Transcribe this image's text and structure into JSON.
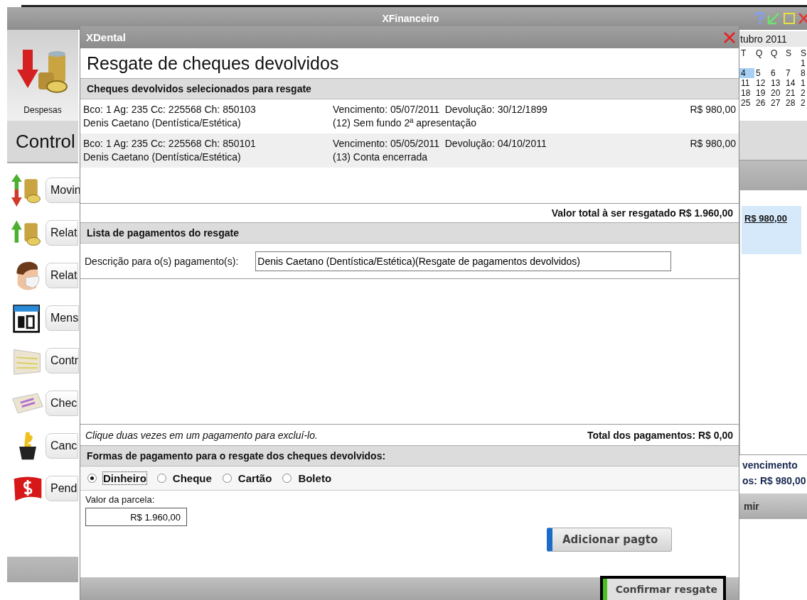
{
  "app": {
    "title": "XFinanceiro",
    "top_tile": {
      "label": "Despesas"
    },
    "heading": "Control",
    "sidebar": {
      "items": [
        {
          "label": "Movin",
          "kind": "transfer"
        },
        {
          "label": "Relat",
          "kind": "income"
        },
        {
          "label": "Relat",
          "kind": "person"
        },
        {
          "label": "Mens",
          "kind": "calendar"
        },
        {
          "label": "Contr",
          "kind": "document"
        },
        {
          "label": "Chec",
          "kind": "cheques"
        },
        {
          "label": "Canc",
          "kind": "bucket"
        },
        {
          "label": "Pend",
          "kind": "flag"
        }
      ]
    },
    "calendar": {
      "month": "tubro 2011",
      "weekdays": [
        "T",
        "Q",
        "Q",
        "S",
        "S"
      ],
      "weeks": [
        {
          "kind": "partial",
          "days": [
            {
              "day": "1",
              "selected": false
            }
          ]
        },
        {
          "kind": "full",
          "days": [
            {
              "day": "4",
              "selected": true
            },
            {
              "day": "5",
              "selected": false
            },
            {
              "day": "6",
              "selected": false
            },
            {
              "day": "7",
              "selected": false
            },
            {
              "day": "8",
              "selected": false
            }
          ]
        },
        {
          "kind": "full",
          "days": [
            {
              "day": "11",
              "selected": false
            },
            {
              "day": "12",
              "selected": false
            },
            {
              "day": "13",
              "selected": false
            },
            {
              "day": "14",
              "selected": false
            },
            {
              "day": "1",
              "selected": false
            }
          ]
        },
        {
          "kind": "full",
          "days": [
            {
              "day": "18",
              "selected": false
            },
            {
              "day": "19",
              "selected": false
            },
            {
              "day": "20",
              "selected": false
            },
            {
              "day": "21",
              "selected": false
            },
            {
              "day": "2",
              "selected": false
            }
          ]
        },
        {
          "kind": "full",
          "days": [
            {
              "day": "25",
              "selected": false
            },
            {
              "day": "26",
              "selected": false
            },
            {
              "day": "27",
              "selected": false
            },
            {
              "day": "28",
              "selected": false
            },
            {
              "day": "2",
              "selected": false
            }
          ]
        }
      ]
    },
    "summary": {
      "amount": "R$ 980,00",
      "due_label": "vencimento",
      "total": "os: R$ 980,00",
      "button": "mir"
    }
  },
  "dialog": {
    "title": "XDental",
    "heading": "Resgate de cheques devolvidos",
    "cheques": {
      "title": "Cheques devolvidos selecionados para resgate",
      "rows": [
        {
          "account": "Bco: 1 Ag: 235 Cc: 225568 Ch: 850103",
          "client": "Denis Caetano (Dentística/Estética)",
          "dates": "Vencimento: 05/07/2011  Devolução: 30/12/1899",
          "reason": "(12) Sem fundo 2ª apresentação",
          "amount": "R$ 980,00"
        },
        {
          "account": "Bco: 1 Ag: 235 Cc: 225568 Ch: 850101",
          "client": "Denis Caetano (Dentística/Estética)",
          "dates": "Vencimento: 05/05/2011  Devolução: 04/10/2011",
          "reason": "(13) Conta encerrada",
          "amount": "R$ 980,00"
        }
      ],
      "total": "Valor total à ser resgatado R$ 1.960,00"
    },
    "payments": {
      "title": "Lista de pagamentos do resgate",
      "description_label": "Descrição para o(s) pagamento(s):",
      "description_value": "Denis Caetano (Dentística/Estética)(Resgate de pagamentos devolvidos)",
      "hint": "Clique duas vezes em um pagamento para excluí-lo.",
      "total": "Total dos pagamentos: R$ 0,00"
    },
    "methods": {
      "title": "Formas de pagamento para o resgate dos cheques devolvidos:",
      "options": [
        {
          "label": "Dinheiro",
          "selected": true
        },
        {
          "label": "Cheque",
          "selected": false
        },
        {
          "label": "Cartão",
          "selected": false
        },
        {
          "label": "Boleto",
          "selected": false
        }
      ]
    },
    "installment": {
      "label": "Valor da parcela:",
      "value": "R$ 1.960,00"
    },
    "add_button": "Adicionar pagto",
    "confirm_button": "Confirmar resgate"
  }
}
